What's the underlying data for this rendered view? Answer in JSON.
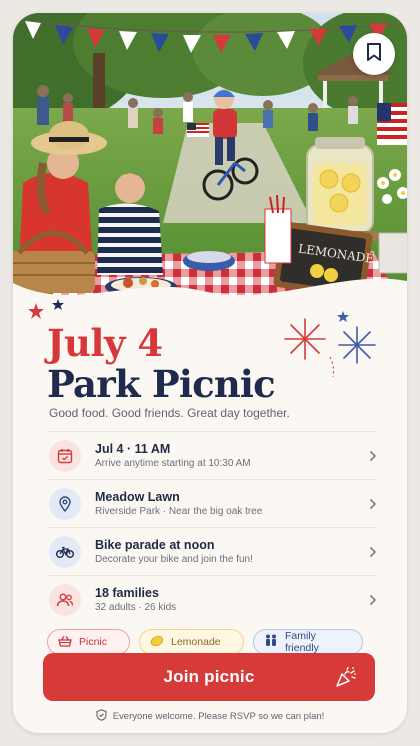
{
  "event": {
    "title_line1": "July 4",
    "title_line2": "Park Picnic",
    "tagline": "Good food. Good friends. Great day together.",
    "sign_text": "LEMONADE"
  },
  "details": [
    {
      "icon": "calendar-icon",
      "title": "Jul 4 · 11 AM",
      "subtitle": "Arrive anytime starting at 10:30 AM"
    },
    {
      "icon": "location-pin-icon",
      "title": "Meadow Lawn",
      "subtitle": "Riverside Park  ·  Near the big oak tree"
    },
    {
      "icon": "bicycle-icon",
      "title": "Bike parade at noon",
      "subtitle": "Decorate your bike and join the fun!"
    },
    {
      "icon": "people-icon",
      "title": "18 families",
      "subtitle": "32 adults · 26 kids"
    }
  ],
  "tags": [
    {
      "label": "Picnic",
      "icon": "basket-icon"
    },
    {
      "label": "Lemonade",
      "icon": "lemon-icon"
    },
    {
      "label": "Family friendly",
      "icon": "family-icon"
    }
  ],
  "cta": {
    "label": "Join picnic",
    "icon": "party-popper-icon"
  },
  "footer": {
    "note": "Everyone welcome. Please RSVP so we can plan!",
    "icon": "shield-icon"
  },
  "colors": {
    "accent_red": "#d63a39",
    "navy": "#1f2b4d",
    "background": "#fbf8f4"
  }
}
